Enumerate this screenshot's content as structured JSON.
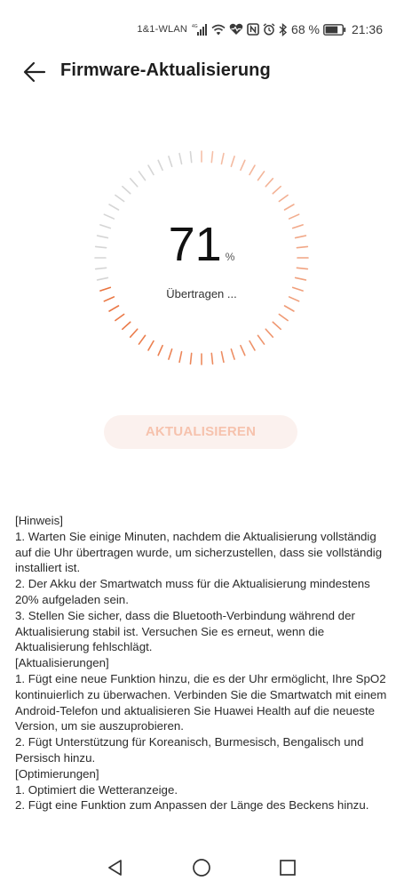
{
  "status_bar": {
    "carrier": "1&1-WLAN",
    "network_type": "4G",
    "battery_percent": "68 %",
    "time": "21:36",
    "icons": [
      "signal-icon",
      "wifi-icon",
      "health-heart-icon",
      "nfc-icon",
      "alarm-icon",
      "bluetooth-icon",
      "battery-icon"
    ]
  },
  "header": {
    "title": "Firmware-Aktualisierung",
    "back_icon": "arrow-left-icon"
  },
  "progress": {
    "value": "71",
    "unit": "%",
    "fraction": 0.71,
    "status": "Übertragen ..."
  },
  "update_button": {
    "label": "AKTUALISIEREN",
    "enabled": false
  },
  "release_notes": {
    "lines": [
      "[Hinweis]",
      "1. Warten Sie einige Minuten, nachdem die Aktualisierung vollständig auf die Uhr übertragen wurde, um sicherzustellen, dass sie vollständig installiert ist.",
      "2. Der Akku der Smartwatch muss für die Aktualisierung mindestens 20% aufgeladen sein.",
      "3. Stellen Sie sicher, dass die Bluetooth-Verbindung während der Aktualisierung stabil ist. Versuchen Sie es erneut, wenn die Aktualisierung fehlschlägt.",
      "[Aktualisierungen]",
      "1. Fügt eine neue Funktion hinzu, die es der Uhr ermöglicht, Ihre SpO2 kontinuierlich zu überwachen. Verbinden Sie die Smartwatch mit einem Android-Telefon und aktualisieren Sie Huawei Health auf die neueste Version, um sie auszuprobieren.",
      "2. Fügt Unterstützung für Koreanisch, Burmesisch, Bengalisch und Persisch hinzu.",
      "[Optimierungen]",
      "1. Optimiert die Wetteranzeige.",
      "2. Fügt eine Funktion zum Anpassen der Länge des Beckens hinzu."
    ]
  },
  "colors": {
    "accent": "#e9733f",
    "track": "#d5d5d5",
    "button_bg": "#fbf1ee",
    "button_text": "#f6c2ad"
  },
  "nav_bar": {
    "icons": [
      "back-triangle-icon",
      "home-circle-icon",
      "recents-square-icon"
    ]
  }
}
